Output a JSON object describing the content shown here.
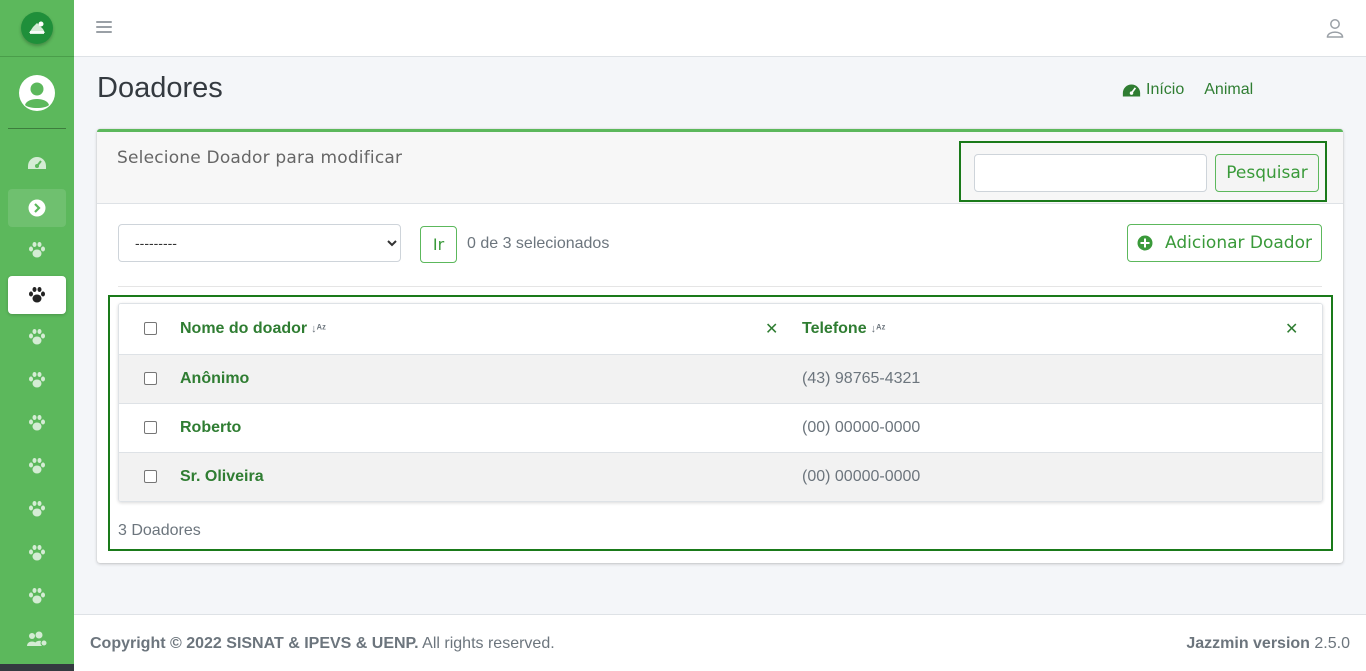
{
  "page": {
    "title": "Doadores"
  },
  "breadcrumbs": [
    {
      "label": "Início",
      "icon": "tachometer-icon"
    },
    {
      "label": "Animal"
    }
  ],
  "card": {
    "title": "Selecione Doador para modificar",
    "search": {
      "value": "",
      "button_label": "Pesquisar"
    },
    "actions": {
      "select_value": "---------",
      "go_label": "Ir",
      "selected_text": "0 de 3 selecionados"
    },
    "add_button_label": "Adicionar Doador"
  },
  "table": {
    "columns": [
      "Nome do doador",
      "Telefone"
    ],
    "rows": [
      {
        "name": "Anônimo",
        "phone": "(43) 98765-4321"
      },
      {
        "name": "Roberto",
        "phone": "(00) 00000-0000"
      },
      {
        "name": "Sr. Oliveira",
        "phone": "(00) 00000-0000"
      }
    ],
    "count_text": "3 Doadores"
  },
  "footer": {
    "copyright": "Copyright © 2022 SISNAT & IPEVS & UENP.",
    "rights": "All rights reserved.",
    "version_label": "Jazzmin version",
    "version_number": "2.5.0"
  },
  "colors": {
    "sidebar": "#5cb85c",
    "accent_text": "#2f7d32",
    "highlight_border": "#1a7a1a"
  }
}
